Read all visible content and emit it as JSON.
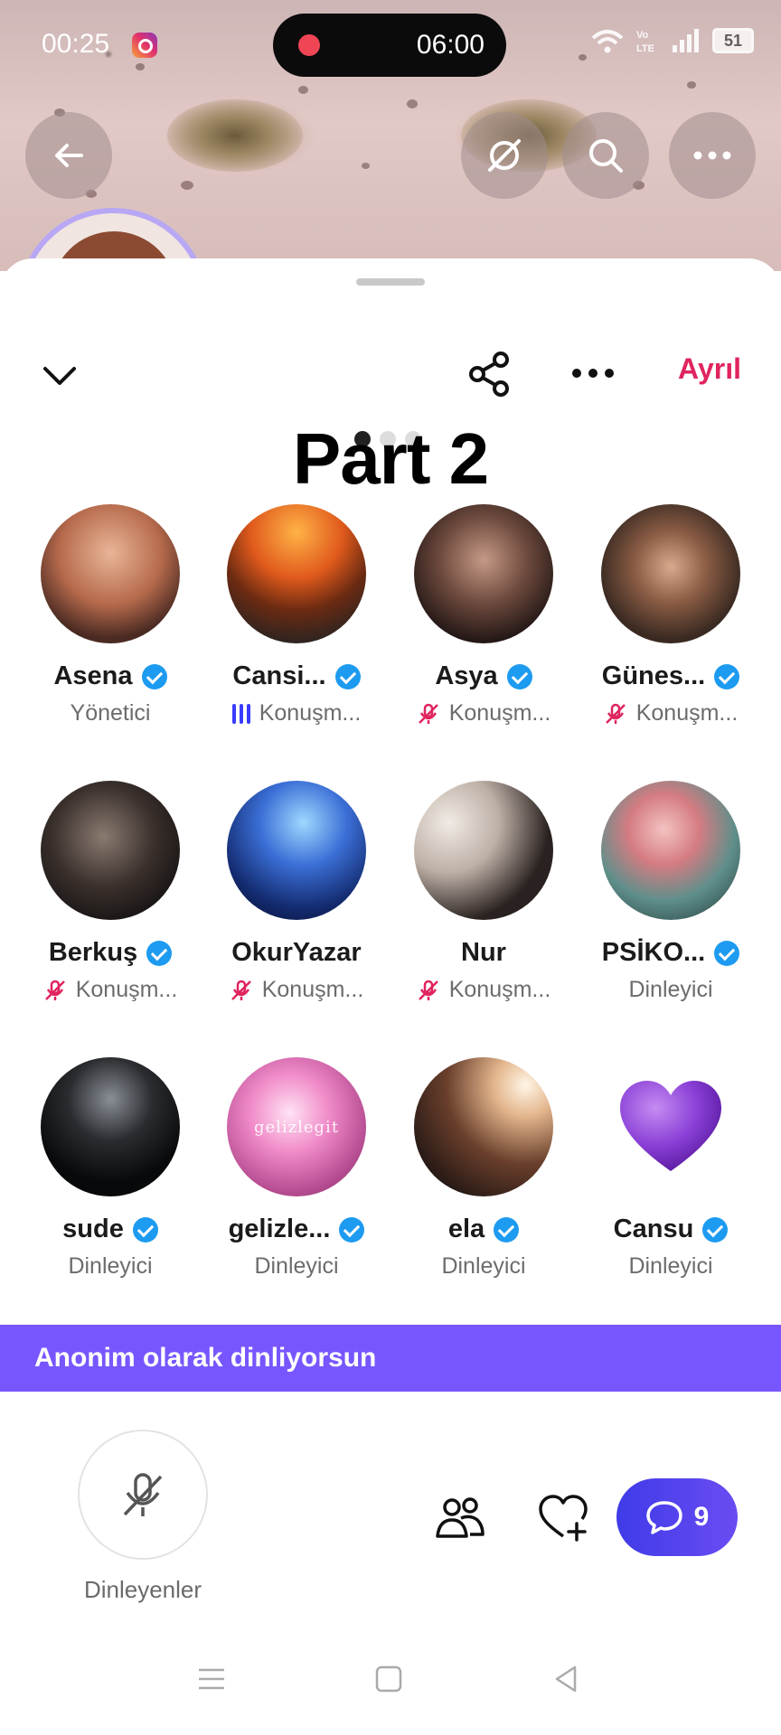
{
  "status_bar": {
    "time": "00:25",
    "recording_time": "06:00",
    "battery": "51"
  },
  "sheet": {
    "leave_label": "Ayrıl"
  },
  "overlay_title": "Part 2",
  "participants": [
    {
      "name": "Asena",
      "verified": true,
      "status": "Yönetici",
      "status_icon": "none"
    },
    {
      "name": "Cansi...",
      "verified": true,
      "status": "Konuşm...",
      "status_icon": "speaking-bars"
    },
    {
      "name": "Asya",
      "verified": true,
      "status": "Konuşm...",
      "status_icon": "mic-off"
    },
    {
      "name": "Günes...",
      "verified": true,
      "status": "Konuşm...",
      "status_icon": "mic-off"
    },
    {
      "name": "Berkuş",
      "verified": true,
      "status": "Konuşm...",
      "status_icon": "mic-off"
    },
    {
      "name": "OkurYazar",
      "verified": false,
      "status": "Konuşm...",
      "status_icon": "mic-off"
    },
    {
      "name": "Nur",
      "verified": false,
      "status": "Konuşm...",
      "status_icon": "mic-off"
    },
    {
      "name": "PSİKO...",
      "verified": true,
      "status": "Dinleyici",
      "status_icon": "none"
    },
    {
      "name": "sude",
      "verified": true,
      "status": "Dinleyici",
      "status_icon": "none"
    },
    {
      "name": "gelizle...",
      "verified": true,
      "status": "Dinleyici",
      "status_icon": "none",
      "avatar_text": "gelizlegit"
    },
    {
      "name": "ela",
      "verified": true,
      "status": "Dinleyici",
      "status_icon": "none"
    },
    {
      "name": "Cansu",
      "verified": true,
      "status": "Dinleyici",
      "status_icon": "none"
    }
  ],
  "anon_banner": "Anonim olarak dinliyorsun",
  "bottom": {
    "listeners_label": "Dinleyenler",
    "chat_count": "9"
  },
  "colors": {
    "accent_purple": "#7856ff",
    "leave_red": "#e0245e",
    "verified_blue": "#1d9bf0",
    "muted_red": "#e0245e"
  }
}
